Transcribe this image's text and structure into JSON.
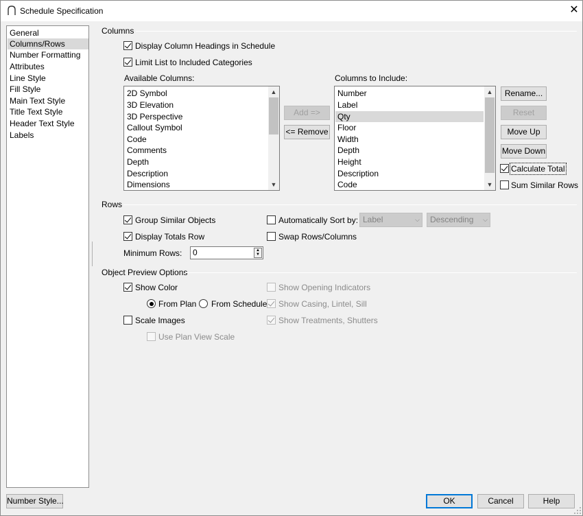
{
  "window": {
    "title": "Schedule Specification",
    "close_glyph": "✕"
  },
  "nav": {
    "items": [
      {
        "label": "General"
      },
      {
        "label": "Columns/Rows"
      },
      {
        "label": "Number Formatting"
      },
      {
        "label": "Attributes"
      },
      {
        "label": "Line Style"
      },
      {
        "label": "Fill Style"
      },
      {
        "label": "Main Text Style"
      },
      {
        "label": "Title Text Style"
      },
      {
        "label": "Header Text Style"
      },
      {
        "label": "Labels"
      }
    ],
    "selected": "Columns/Rows"
  },
  "columns": {
    "heading": "Columns",
    "display_headings": {
      "label": "Display Column Headings in Schedule",
      "checked": true
    },
    "limit_list": {
      "label": "Limit List to Included Categories",
      "checked": true
    },
    "available_label": "Available Columns:",
    "available": [
      "2D Symbol",
      "3D Elevation",
      "3D Perspective",
      "Callout Symbol",
      "Code",
      "Comments",
      "Depth",
      "Description",
      "Dimensions"
    ],
    "include_label": "Columns to Include:",
    "include": [
      "Number",
      "Label",
      "Qty",
      "Floor",
      "Width",
      "Depth",
      "Height",
      "Description",
      "Code"
    ],
    "include_selected": "Qty",
    "add_button": "Add =>",
    "remove_button": "<= Remove",
    "rename_button": "Rename...",
    "reset_button": "Reset",
    "move_up_button": "Move Up",
    "move_down_button": "Move Down",
    "calculate_total": {
      "label": "Calculate Total",
      "checked": true
    },
    "sum_similar": {
      "label": "Sum Similar Rows",
      "checked": false
    }
  },
  "rows": {
    "heading": "Rows",
    "group_similar": {
      "label": "Group Similar Objects",
      "checked": true
    },
    "display_totals": {
      "label": "Display Totals Row",
      "checked": true
    },
    "auto_sort": {
      "label": "Automatically Sort by:",
      "checked": false
    },
    "sort_field": "Label",
    "sort_order": "Descending",
    "swap": {
      "label": "Swap Rows/Columns",
      "checked": false
    },
    "min_rows_label": "Minimum Rows:",
    "min_rows_value": "0"
  },
  "preview": {
    "heading": "Object Preview Options",
    "show_color": {
      "label": "Show Color",
      "checked": true
    },
    "from_plan": {
      "label": "From Plan",
      "checked": true
    },
    "from_schedule": {
      "label": "From Schedule",
      "checked": false
    },
    "scale_images": {
      "label": "Scale Images",
      "checked": false
    },
    "use_plan_view_scale": {
      "label": "Use Plan View Scale",
      "checked": false
    },
    "show_opening_indicators": {
      "label": "Show Opening Indicators",
      "checked": false
    },
    "show_casing": {
      "label": "Show Casing, Lintel, Sill",
      "checked": true
    },
    "show_treatments": {
      "label": "Show Treatments, Shutters",
      "checked": true
    }
  },
  "footer": {
    "number_style": "Number Style...",
    "ok": "OK",
    "cancel": "Cancel",
    "help": "Help"
  },
  "colors": {
    "accent": "#0078d7",
    "selection": "#d9d9d9"
  }
}
